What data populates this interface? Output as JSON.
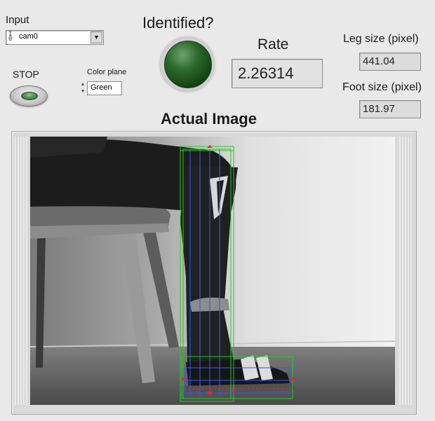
{
  "input": {
    "label": "Input",
    "icon": "io-icon",
    "io_glyph_top": "I",
    "io_glyph_bottom": "0",
    "selected": "cam0"
  },
  "stop": {
    "label": "STOP"
  },
  "color_plane": {
    "label": "Color plane",
    "value": "Green"
  },
  "identified": {
    "label": "Identified?",
    "led_color": "#2c6a2c",
    "state": "on"
  },
  "rate": {
    "label": "Rate",
    "value": "2.26314"
  },
  "leg_size": {
    "label": "Leg size (pixel)",
    "value": "441.04"
  },
  "foot_size": {
    "label": "Foot size (pixel)",
    "value": "181.97"
  },
  "image_panel": {
    "title": "Actual Image",
    "overlay_green": "#27c927",
    "overlay_blue": "#2f5bff",
    "overlay_red": "#ff2020"
  }
}
